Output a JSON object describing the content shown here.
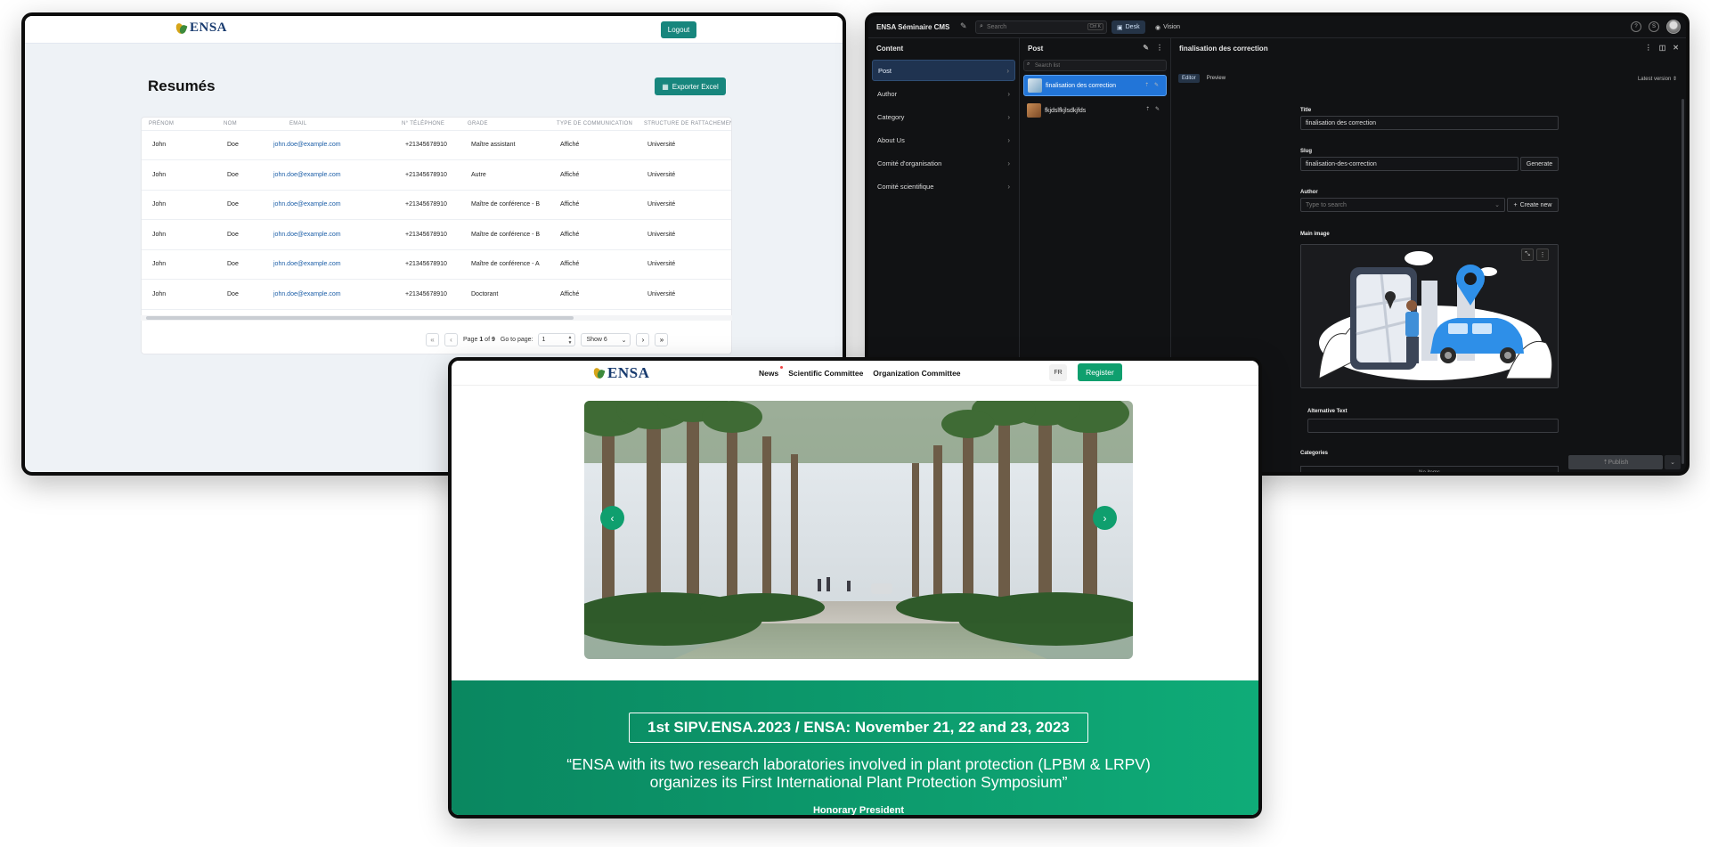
{
  "admin": {
    "logo_text": "ENSA",
    "logout_label": "Logout",
    "page_title": "Resumés",
    "export_label": "Exporter Excel",
    "columns": [
      "Prénom",
      "Nom",
      "Email",
      "N° Téléphone",
      "Grade",
      "Type de communication",
      "Structure de rattachement"
    ],
    "rows": [
      [
        "John",
        "Doe",
        "john.doe@example.com",
        "+21345678910",
        "Maître assistant",
        "Affiché",
        "Université"
      ],
      [
        "John",
        "Doe",
        "john.doe@example.com",
        "+21345678910",
        "Autre",
        "Affiché",
        "Université"
      ],
      [
        "John",
        "Doe",
        "john.doe@example.com",
        "+21345678910",
        "Maître de conférence - B",
        "Affiché",
        "Université"
      ],
      [
        "John",
        "Doe",
        "john.doe@example.com",
        "+21345678910",
        "Maître de conférence - B",
        "Affiché",
        "Université"
      ],
      [
        "John",
        "Doe",
        "john.doe@example.com",
        "+21345678910",
        "Maître de conférence - A",
        "Affiché",
        "Université"
      ],
      [
        "John",
        "Doe",
        "john.doe@example.com",
        "+21345678910",
        "Doctorant",
        "Affiché",
        "Université"
      ]
    ],
    "pager": {
      "page_prefix": "Page",
      "page_current": "1",
      "page_of": "of",
      "page_total": "9",
      "goto_label": "Go to page:",
      "goto_value": "1",
      "show_label": "Show 6"
    }
  },
  "cms": {
    "title": "ENSA Séminaire CMS",
    "search_placeholder": "Search",
    "search_shortcut": "Ctrl K",
    "tab_desk": "Desk",
    "tab_vision": "Vision",
    "content_header": "Content",
    "content_items": [
      "Post",
      "Author",
      "Category",
      "About Us",
      "Comité d'organisation",
      "Comité scientifique"
    ],
    "post_header": "Post",
    "list_search_placeholder": "Search list",
    "posts": [
      "finalisation des correction",
      "fkjdslfkjlsdkjfds"
    ],
    "doc_title": "finalisation des correction",
    "editor_tab": "Editor",
    "preview_tab": "Preview",
    "version_label": "Latest version",
    "title_label": "Title",
    "title_value": "finalisation des correction",
    "slug_label": "Slug",
    "slug_value": "finalisation-des-correction",
    "generate_label": "Generate",
    "author_label": "Author",
    "author_placeholder": "Type to search",
    "create_new_label": "Create new",
    "main_image_label": "Main image",
    "alt_text_label": "Alternative Text",
    "categories_label": "Categories",
    "no_items_label": "No items",
    "publish_label": "Publish"
  },
  "site": {
    "logo_text": "ENSA",
    "nav": [
      "News",
      "Scientific Committee",
      "Organization Committee"
    ],
    "lang": "FR",
    "register_label": "Register",
    "banner_title": "1st SIPV.ENSA.2023 / ENSA: November 21, 22 and 23, 2023",
    "banner_quote": "“ENSA with its two research laboratories involved in plant protection (LPBM & LRPV) organizes its First International Plant Protection Symposium”",
    "banner_sub": "Honorary President"
  },
  "colors": {
    "teal": "#17867d",
    "green": "#0f9f6e",
    "cms_bg": "#111214",
    "cms_select": "#2275d8"
  }
}
